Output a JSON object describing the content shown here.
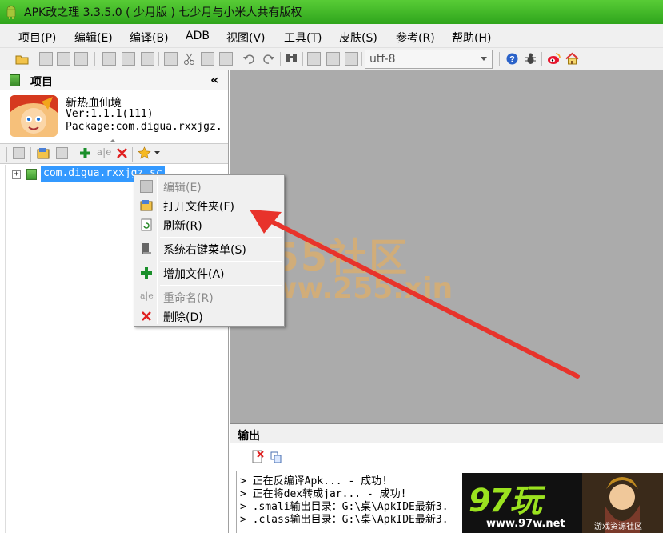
{
  "window": {
    "title": "APK改之理 3.3.5.0 ( 少月版 )  七少月与小米人共有版权"
  },
  "menu": [
    {
      "label": "项目(P)"
    },
    {
      "label": "编辑(E)"
    },
    {
      "label": "编译(B)"
    },
    {
      "label": "ADB"
    },
    {
      "label": "视图(V)"
    },
    {
      "label": "工具(T)"
    },
    {
      "label": "皮肤(S)"
    },
    {
      "label": "参考(R)"
    },
    {
      "label": "帮助(H)"
    }
  ],
  "toolbar": {
    "encoding": "utf-8"
  },
  "project_panel": {
    "title": "项目",
    "collapse": "«",
    "app_name": "新热血仙境",
    "app_version": "Ver:1.1.1(111)",
    "app_package": "Package:com.digua.rxxjgz.",
    "tree_node": "com.digua.rxxjgz.sc",
    "expander": "+"
  },
  "context_menu": {
    "items": [
      {
        "label": "编辑(E)",
        "icon": "edit-icon",
        "enabled": false
      },
      {
        "label": "打开文件夹(F)",
        "icon": "open-folder-icon",
        "enabled": true
      },
      {
        "label": "刷新(R)",
        "icon": "refresh-icon",
        "enabled": true
      },
      {
        "label": "系统右键菜单(S)",
        "icon": "system-menu-icon",
        "enabled": true
      },
      {
        "label": "增加文件(A)",
        "icon": "add-file-icon",
        "enabled": true
      },
      {
        "label": "重命名(R)",
        "icon": "rename-icon",
        "enabled": false
      },
      {
        "label": "删除(D)",
        "icon": "delete-icon",
        "enabled": true
      }
    ]
  },
  "output": {
    "title": "输出",
    "lines": [
      ">  正在反编译Apk...   - 成功!",
      ">  正在将dex转成jar...   - 成功!",
      ">  .smali输出目录：G:\\桌\\ApkIDE最新3.",
      ">  .class输出目录：G:\\桌\\ApkIDE最新3."
    ]
  },
  "watermark": {
    "line1": "255社区",
    "line2": "www.255.xin"
  },
  "ad": {
    "logo": "97玩",
    "url": "www.97w.net",
    "tagline": "游戏资源社区"
  },
  "colors": {
    "titlebar": "#3fb426",
    "selection": "#3399ff",
    "arrow": "#e8332b",
    "editor_bg": "#ababab"
  }
}
